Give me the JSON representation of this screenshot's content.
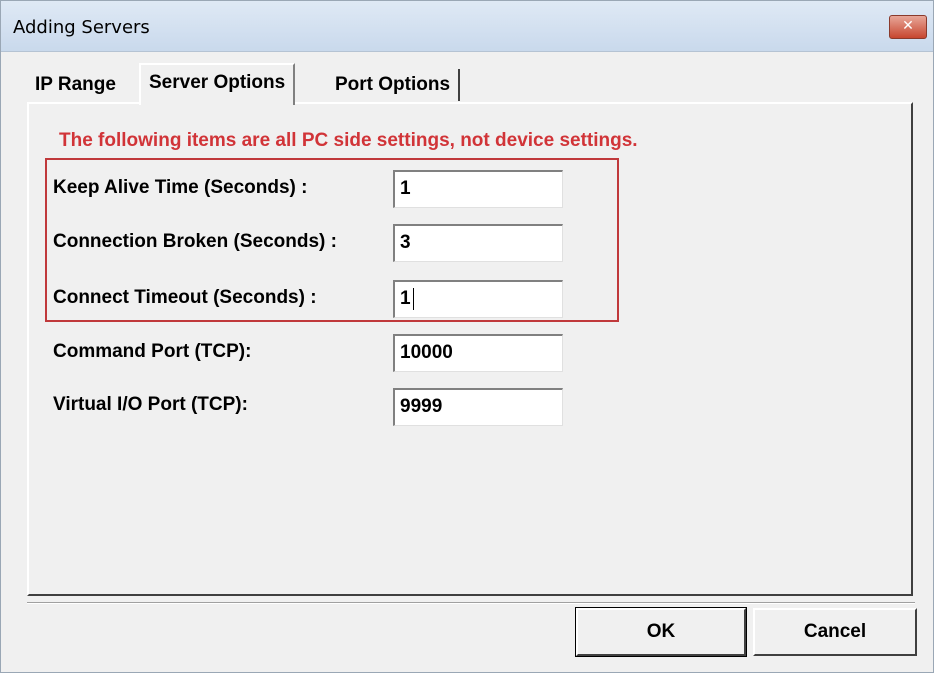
{
  "window": {
    "title": "Adding Servers",
    "close_label": "✕"
  },
  "tabs": [
    {
      "label": "IP Range",
      "active": false
    },
    {
      "label": "Server Options",
      "active": true
    },
    {
      "label": "Port Options",
      "active": false
    }
  ],
  "panel": {
    "notice": "The following items are all PC side settings, not device settings.",
    "fields": [
      {
        "label": "Keep Alive Time (Seconds) :",
        "value": "1"
      },
      {
        "label": "Connection Broken (Seconds) :",
        "value": "3"
      },
      {
        "label": "Connect Timeout (Seconds) :",
        "value": "1"
      },
      {
        "label": "Command Port (TCP):",
        "value": "10000"
      },
      {
        "label": "Virtual I/O Port (TCP):",
        "value": "9999"
      }
    ]
  },
  "buttons": {
    "ok": "OK",
    "cancel": "Cancel"
  },
  "colors": {
    "notice": "#d13438",
    "highlight_border": "#c0393b",
    "close_button": "#c7462f"
  }
}
